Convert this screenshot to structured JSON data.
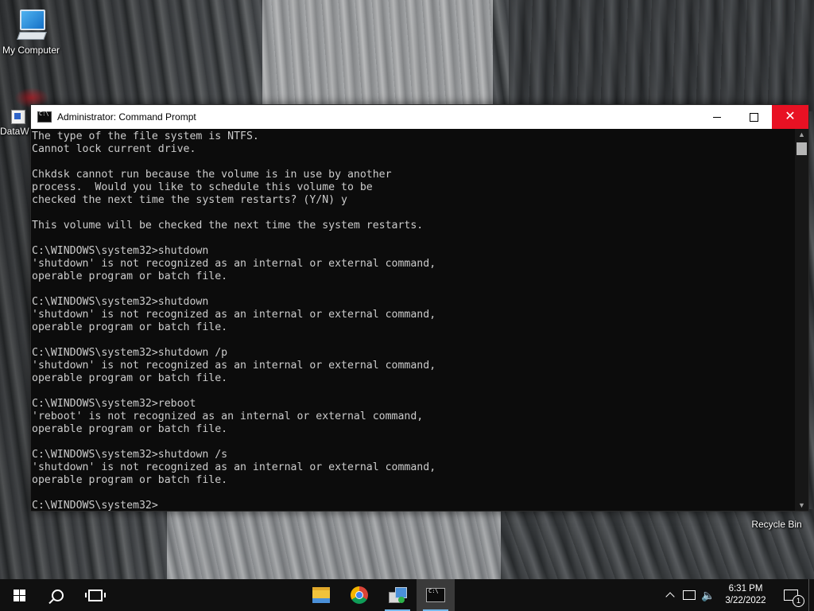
{
  "desktop": {
    "icons": [
      {
        "label": "My Computer"
      },
      {
        "label": "DataW"
      },
      {
        "label": "Recycle Bin"
      }
    ]
  },
  "window": {
    "title": "Administrator: Command Prompt",
    "minimize_glyph": "—",
    "close_glyph": "✕"
  },
  "console": {
    "text": "The type of the file system is NTFS.\nCannot lock current drive.\n\nChkdsk cannot run because the volume is in use by another\nprocess.  Would you like to schedule this volume to be\nchecked the next time the system restarts? (Y/N) y\n\nThis volume will be checked the next time the system restarts.\n\nC:\\WINDOWS\\system32>shutdown\n'shutdown' is not recognized as an internal or external command,\noperable program or batch file.\n\nC:\\WINDOWS\\system32>shutdown\n'shutdown' is not recognized as an internal or external command,\noperable program or batch file.\n\nC:\\WINDOWS\\system32>shutdown /p\n'shutdown' is not recognized as an internal or external command,\noperable program or batch file.\n\nC:\\WINDOWS\\system32>reboot\n'reboot' is not recognized as an internal or external command,\noperable program or batch file.\n\nC:\\WINDOWS\\system32>shutdown /s\n'shutdown' is not recognized as an internal or external command,\noperable program or batch file.\n\nC:\\WINDOWS\\system32>",
    "background": "#0c0c0c",
    "foreground": "#cccccc"
  },
  "taskbar": {
    "apps": [
      {
        "icon": "file-explorer-icon"
      },
      {
        "icon": "chrome-icon"
      },
      {
        "icon": "network-admin-icon"
      },
      {
        "icon": "command-prompt-icon",
        "active": true
      }
    ],
    "clock": {
      "time": "6:31 PM",
      "date": "3/22/2022"
    },
    "notification_count": "1"
  },
  "colors": {
    "close_button": "#e81123",
    "taskbar": "#101010",
    "running_indicator": "#76b9ed"
  }
}
